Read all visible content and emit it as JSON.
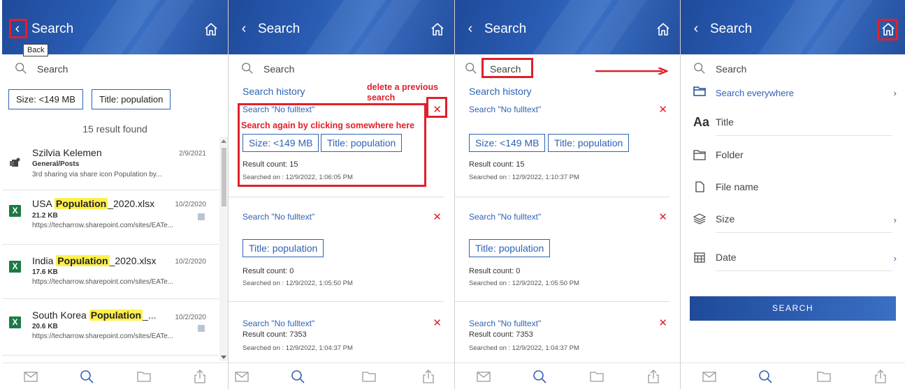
{
  "header": {
    "title": "Search"
  },
  "tooltip": {
    "back": "Back"
  },
  "search": {
    "placeholder": "Search"
  },
  "panel1": {
    "chips": [
      "Size: <149 MB",
      "Title: population"
    ],
    "result_count": "15 result found",
    "results": [
      {
        "icon": "teams-icon",
        "title_pre": "Szilvia Kelemen",
        "title_hl": "",
        "title_post": "",
        "date": "2/9/2021",
        "sub": "General/Posts",
        "url": "3rd sharing via share icon Population by..."
      },
      {
        "icon": "excel-icon",
        "title_pre": "USA ",
        "title_hl": "Population",
        "title_post": "_2020.xlsx",
        "date": "10/2/2020",
        "sub": "21.2 KB",
        "url": "https://techarrow.sharepoint.com/sites/EATe..."
      },
      {
        "icon": "excel-icon",
        "title_pre": "India ",
        "title_hl": "Population",
        "title_post": "_2020.xlsx",
        "date": "10/2/2020",
        "sub": "17.6 KB",
        "url": "https://techarrow.sharepoint.com/sites/EATe..."
      },
      {
        "icon": "excel-icon",
        "title_pre": "South Korea ",
        "title_hl": "Population",
        "title_post": "_...",
        "date": "10/2/2020",
        "sub": "20.6 KB",
        "url": "https://techarrow.sharepoint.com/sites/EATe..."
      }
    ],
    "excel_glyph": "X"
  },
  "history": {
    "title": "Search history",
    "entries": [
      {
        "title": "Search \"No fulltext\"",
        "chips": [
          "Size: <149 MB",
          "Title: population"
        ],
        "count": "Result count: 15",
        "date_p2": "Searched on : 12/9/2022, 1:06:05 PM",
        "date_p3": "Searched on : 12/9/2022, 1:10:37 PM"
      },
      {
        "title": "Search \"No fulltext\"",
        "chips": [
          "Title: population"
        ],
        "count": "Result count: 0",
        "date_p2": "Searched on : 12/9/2022, 1:05:50 PM",
        "date_p3": "Searched on : 12/9/2022, 1:05:50 PM"
      },
      {
        "title": "Search \"No fulltext\"",
        "chips": [],
        "count": "Result count: 7353",
        "date_p2": "Searched on : 12/9/2022, 1:04:37 PM",
        "date_p3": "Searched on : 12/9/2022, 1:04:37 PM"
      }
    ]
  },
  "annotations": {
    "delete_previous": "delete a previous search",
    "search_again": "Search again by clicking somewhere here"
  },
  "panel4": {
    "scope": "Search everywhere",
    "options": [
      {
        "icon": "title-icon",
        "label": "Title",
        "chevron": false
      },
      {
        "icon": "folder-icon",
        "label": "Folder",
        "chevron": false
      },
      {
        "icon": "file-icon",
        "label": "File name",
        "chevron": false
      },
      {
        "icon": "layers-icon",
        "label": "Size",
        "chevron": true
      },
      {
        "icon": "calendar-icon",
        "label": "Date",
        "chevron": true
      }
    ],
    "title_glyph": "Aa",
    "search_button": "SEARCH"
  },
  "glyphs": {
    "back": "‹",
    "close": "✕",
    "chevron": "›"
  },
  "tabs": [
    "mail-icon",
    "search-icon",
    "folder-icon",
    "share-icon"
  ],
  "colors": {
    "brand_blue": "#2f62b6",
    "header_blue": "#1f4a9a",
    "annotation_red": "#e0202a",
    "highlight": "#fff04a",
    "excel_green": "#1d7a45"
  }
}
